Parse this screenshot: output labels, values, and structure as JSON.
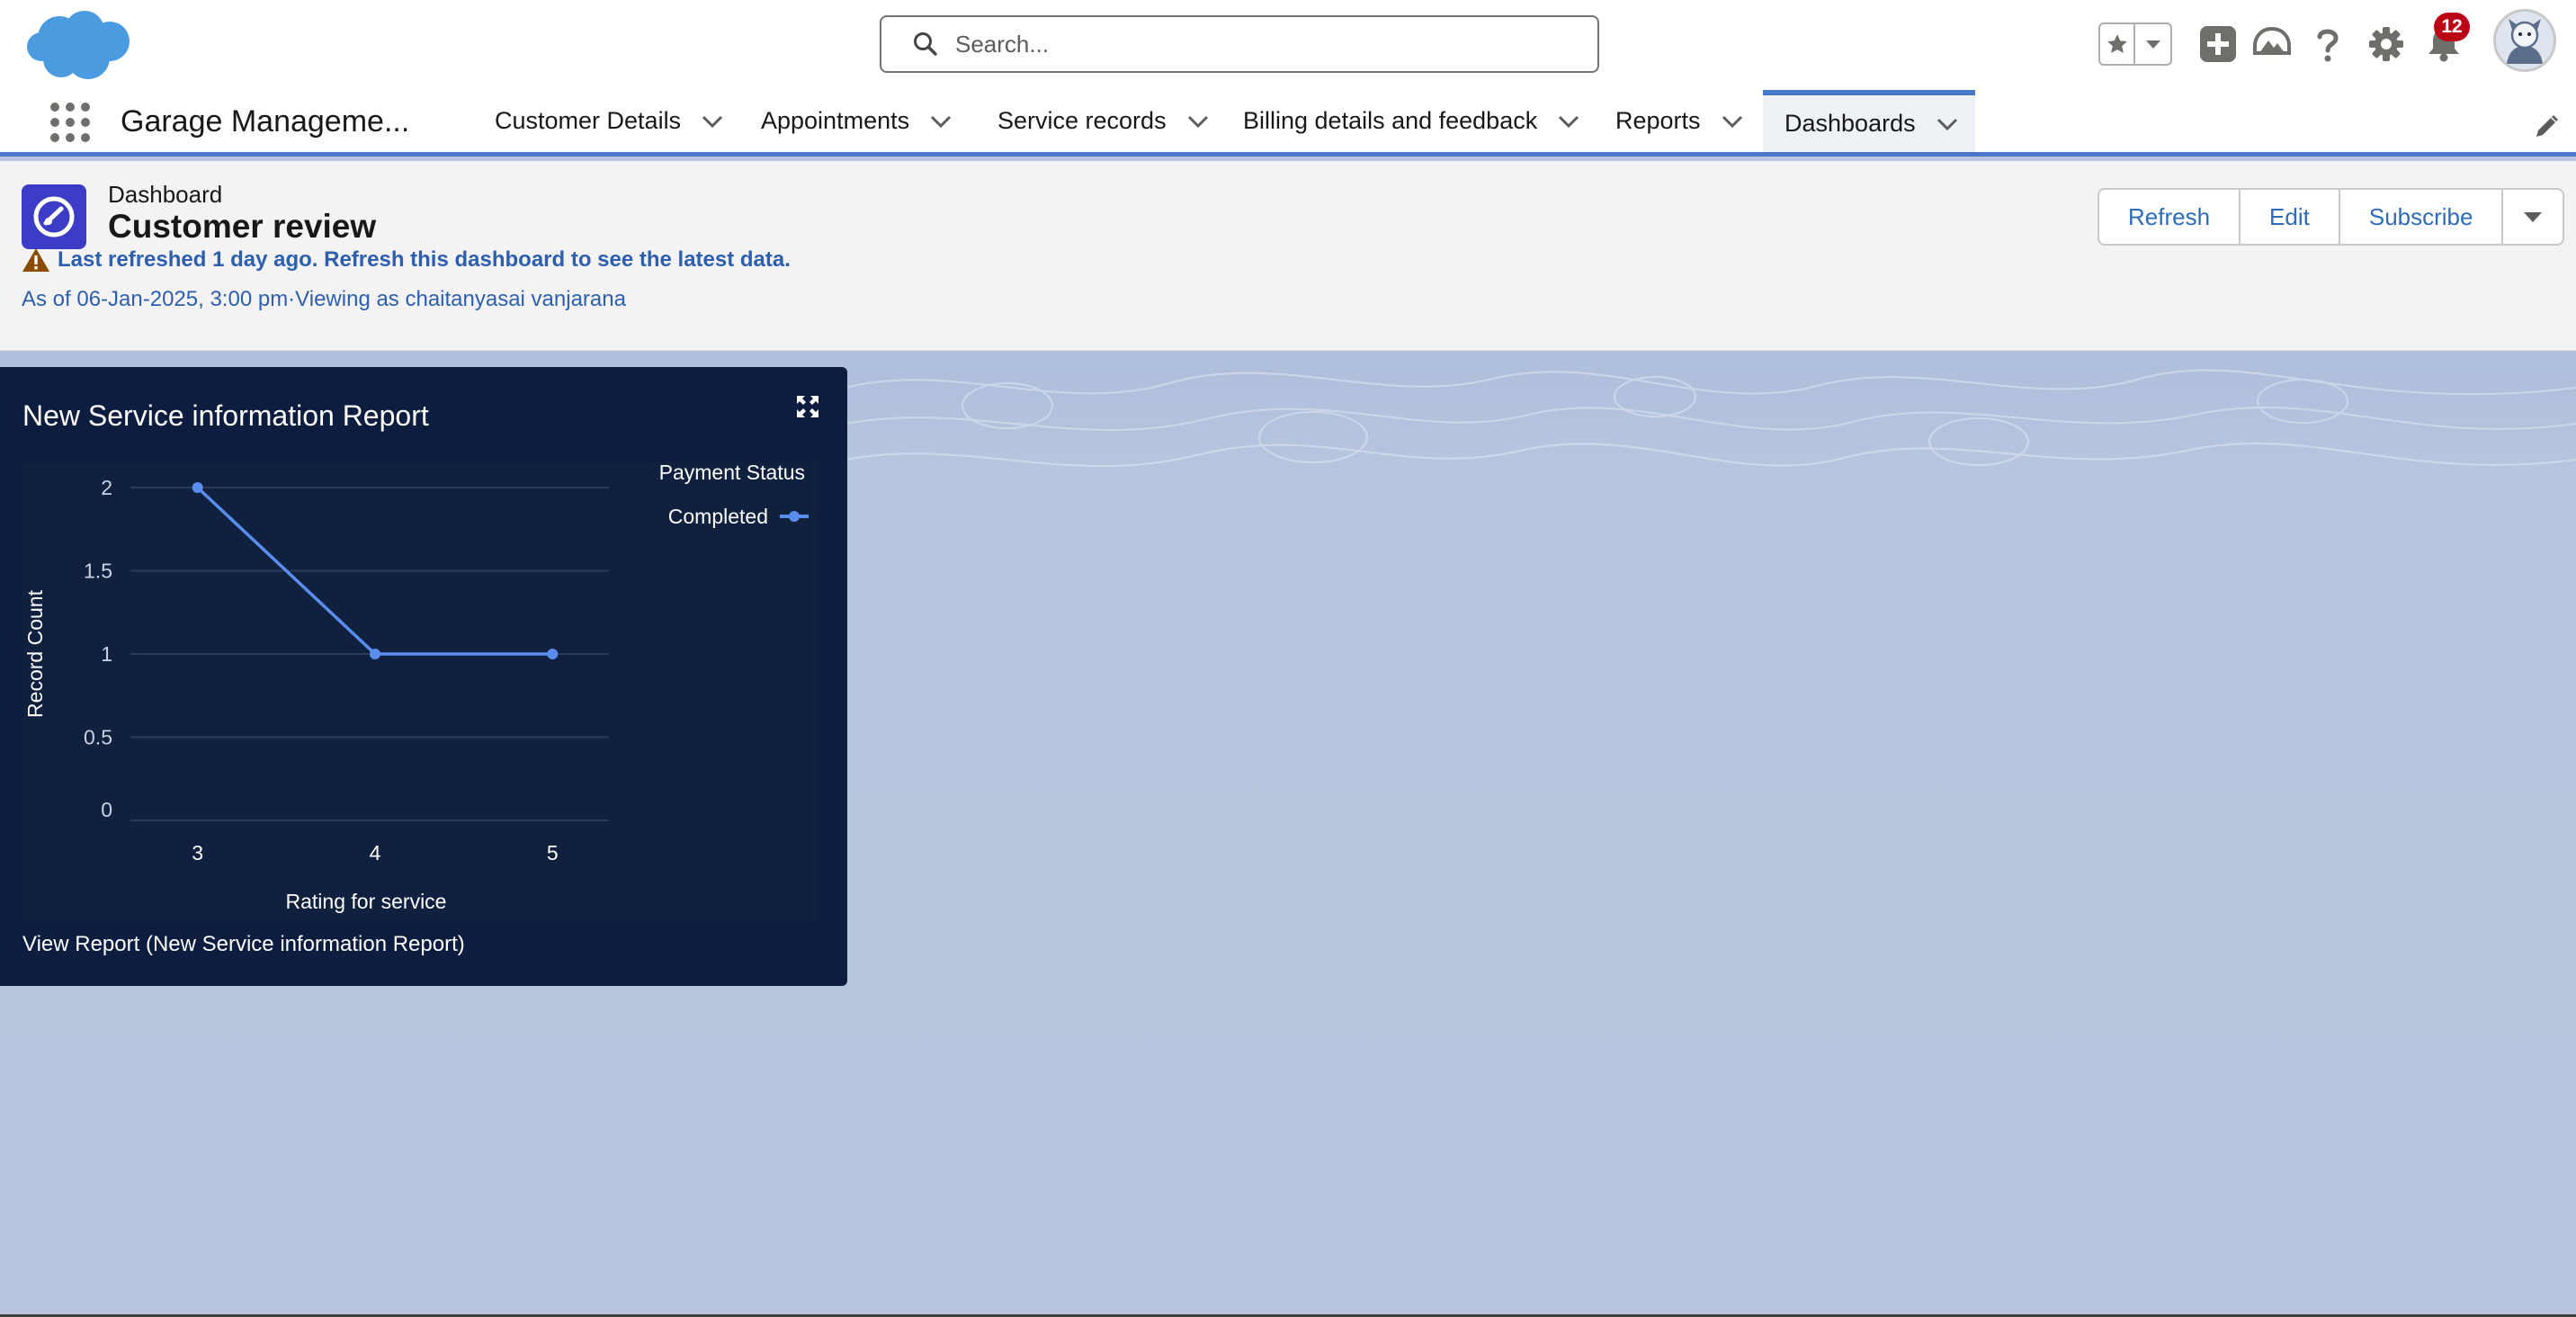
{
  "header": {
    "search_placeholder": "Search...",
    "notification_count": "12",
    "icons": [
      "salesforce-cloud-logo",
      "search-icon",
      "star-icon",
      "chevron-down-icon",
      "plus-icon",
      "trailhead-icon",
      "help-icon",
      "gear-icon",
      "bell-icon",
      "avatar"
    ]
  },
  "nav": {
    "app_name": "Garage Manageme...",
    "tabs": [
      {
        "label": "Customer Details"
      },
      {
        "label": "Appointments"
      },
      {
        "label": "Service records"
      },
      {
        "label": "Billing details and feedback"
      },
      {
        "label": "Reports"
      },
      {
        "label": "Dashboards",
        "active": true
      }
    ]
  },
  "dashboard": {
    "type_label": "Dashboard",
    "title": "Customer review",
    "warning": "Last refreshed 1 day ago. Refresh this dashboard to see the latest data.",
    "as_of": "As of 06-Jan-2025, 3:00 pm·Viewing as chaitanyasai vanjarana",
    "buttons": {
      "refresh": "Refresh",
      "edit": "Edit",
      "subscribe": "Subscribe"
    }
  },
  "widget": {
    "title": "New Service information Report",
    "view_report": "View Report (New Service information Report)"
  },
  "colors": {
    "brand_blue": "#4a78c8",
    "widget_bg": "#0c1d3f",
    "series_line": "#5b8def",
    "link": "#2e5fae",
    "badge": "#ba0517",
    "dashboard_icon": "#3b3dc7"
  },
  "chart_data": {
    "type": "line",
    "xlabel": "Rating for service",
    "ylabel": "Record Count",
    "categories": [
      "3",
      "4",
      "5"
    ],
    "y_ticks": [
      "0",
      "0.5",
      "1",
      "1.5",
      "2"
    ],
    "ylim": [
      0,
      2
    ],
    "legend_title": "Payment Status",
    "legend_position": "top-right",
    "grid": true,
    "series": [
      {
        "name": "Completed",
        "values": [
          2,
          1,
          1
        ]
      }
    ]
  }
}
